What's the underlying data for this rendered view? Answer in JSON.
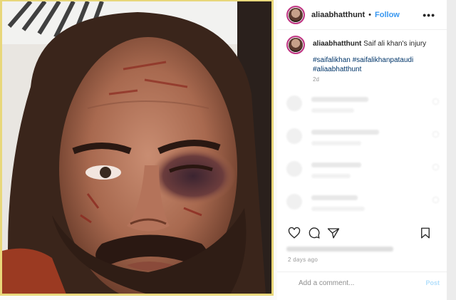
{
  "post": {
    "username": "aliaabhatthunt",
    "dot": "•",
    "follow_label": "Follow",
    "more_label": "•••"
  },
  "caption": {
    "username": "aliaabhatthunt",
    "text": "Saif ali khan's injury",
    "hashtags": [
      "#saifalikhan",
      "#saifalikhanpataudi",
      "#aliaabhatthunt"
    ],
    "age": "2d"
  },
  "comments_count_visible": 4,
  "actions": {
    "like_icon": "heart-icon",
    "comment_icon": "comment-icon",
    "share_icon": "share-icon",
    "save_icon": "bookmark-icon"
  },
  "timestamp": "2 days ago",
  "add_comment": {
    "placeholder": "Add a comment...",
    "post_label": "Post"
  },
  "colors": {
    "follow": "#3897f0",
    "hashtag": "#003569",
    "photo_border": "#e8d77a"
  }
}
